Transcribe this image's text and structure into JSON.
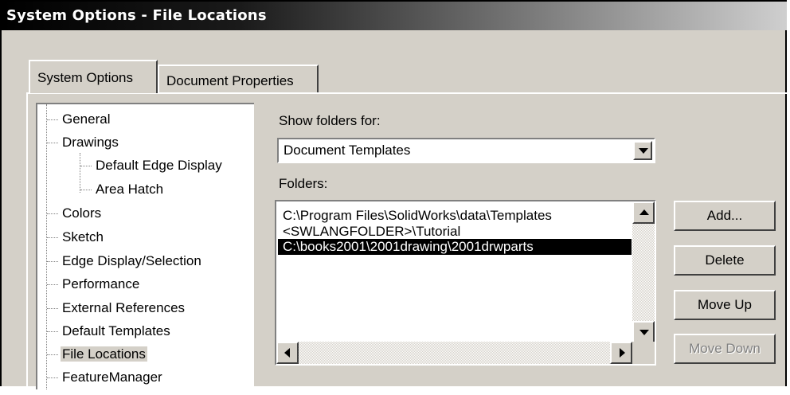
{
  "window": {
    "title": "System Options - File Locations"
  },
  "tabs": [
    {
      "label": "System Options",
      "active": true
    },
    {
      "label": "Document Properties",
      "active": false
    }
  ],
  "tree": {
    "items": [
      {
        "label": "General",
        "level": 0
      },
      {
        "label": "Drawings",
        "level": 0
      },
      {
        "label": "Default Edge Display",
        "level": 1
      },
      {
        "label": "Area Hatch",
        "level": 1
      },
      {
        "label": "Colors",
        "level": 0
      },
      {
        "label": "Sketch",
        "level": 0
      },
      {
        "label": "Edge Display/Selection",
        "level": 0
      },
      {
        "label": "Performance",
        "level": 0
      },
      {
        "label": "External References",
        "level": 0
      },
      {
        "label": "Default Templates",
        "level": 0
      },
      {
        "label": "File Locations",
        "level": 0,
        "selected": true
      },
      {
        "label": "FeatureManager",
        "level": 0
      }
    ]
  },
  "show_folders": {
    "label": "Show folders for:",
    "selected": "Document Templates"
  },
  "folders": {
    "label": "Folders:",
    "items": [
      {
        "path": "C:\\Program Files\\SolidWorks\\data\\Templates",
        "selected": false
      },
      {
        "path": "<SWLANGFOLDER>\\Tutorial",
        "selected": false
      },
      {
        "path": "C:\\books2001\\2001drawing\\2001drwparts",
        "selected": true
      }
    ]
  },
  "buttons": {
    "add": "Add...",
    "delete": "Delete",
    "move_up": "Move Up",
    "move_down": "Move Down",
    "move_down_enabled": false
  },
  "icons": {
    "dropdown": "chevron-down-icon",
    "scroll_up": "arrow-up-icon",
    "scroll_down": "arrow-down-icon",
    "scroll_left": "arrow-left-icon",
    "scroll_right": "arrow-right-icon"
  },
  "colors": {
    "dialog_bg": "#d4d0c8",
    "title_start": "#000000",
    "selection_bg": "#000000",
    "selection_text": "#ffffff",
    "disabled_text": "#808080"
  }
}
